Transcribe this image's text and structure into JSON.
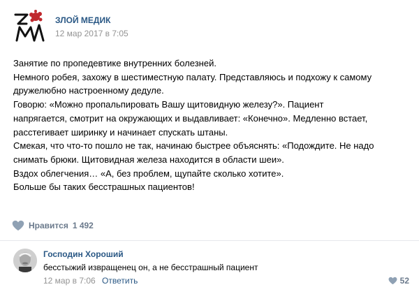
{
  "post": {
    "author": "ЗЛОЙ МЕДИК",
    "date": "12 мар 2017 в 7:05",
    "text_lines": [
      "Занятие по пропедевтике внутренних болезней.",
      "Немного робея, захожу в шестиместную палату. Представляюсь и подхожу к самому",
      "дружелюбно настроенному дедуле.",
      "Говорю: «Можно пропальпировать Вашу щитовидную железу?». Пациент",
      "напрягается, смотрит на окружающих и выдавливает: «Конечно». Медленно встает,",
      "расстегивает ширинку и начинает спускать штаны.",
      "Смекая, что что-то пошло не так, начинаю быстрее объяснять: «Подождите. Не надо",
      "снимать брюки. Щитовидная железа находится в области шеи».",
      "Вздох облегчения… «А, без проблем, щупайте сколько хотите».",
      "Больше бы таких бесстрашных пациентов!"
    ],
    "like_label": "Нравится",
    "like_count": "1 492",
    "icons": {
      "logo": "logo-icon",
      "like": "heart-icon"
    }
  },
  "comment": {
    "author": "Господин Хороший",
    "text": "бесстыжий извращенец он, а не бесстрашный пациент",
    "date": "12 мар в 7:06",
    "reply_label": "Ответить",
    "like_count": "52"
  },
  "colors": {
    "link": "#2a5885",
    "meta": "#939393",
    "like": "#6b7a8c",
    "logo_red": "#c0282d"
  }
}
